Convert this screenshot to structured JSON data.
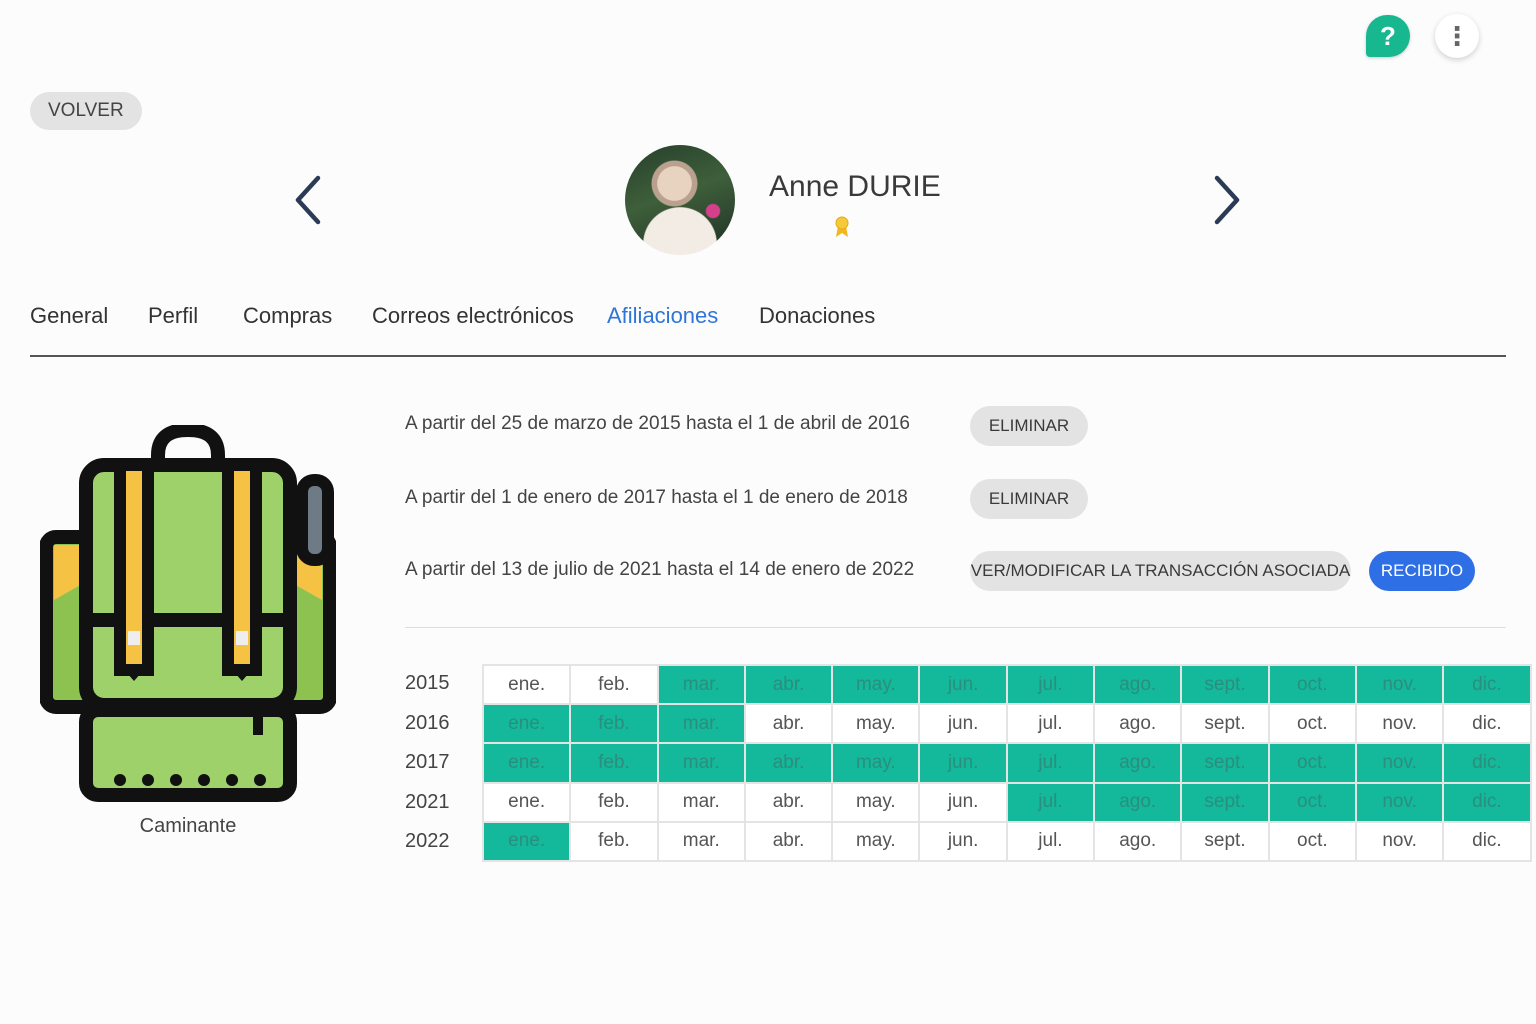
{
  "header": {
    "help_icon": "question-icon",
    "more_icon": "vertical-dots-icon",
    "help_label": "?",
    "more_label": "⋮"
  },
  "back_label": "VOLVER",
  "profile": {
    "name": "Anne DURIE",
    "badge_icon": "award-ribbon-icon"
  },
  "tabs": [
    {
      "label": "General"
    },
    {
      "label": "Perfil"
    },
    {
      "label": "Compras"
    },
    {
      "label": "Correos electrónicos"
    },
    {
      "label": "Afiliaciones",
      "active": true
    },
    {
      "label": "Donaciones"
    }
  ],
  "membership": {
    "icon": "backpack-icon",
    "caption": "Caminante"
  },
  "periods": [
    {
      "text": "A partir del 25 de marzo de 2015 hasta el 1 de abril de 2016",
      "action": "ELIMINAR"
    },
    {
      "text": "A partir del 1 de enero de 2017 hasta el 1 de enero de 2018",
      "action": "ELIMINAR"
    },
    {
      "text": "A partir del 13 de julio de 2021 hasta el 14 de enero de 2022",
      "action": "VER/MODIFICAR LA TRANSACCIÓN ASOCIADA",
      "status": "RECIBIDO"
    }
  ],
  "months": [
    "ene.",
    "feb.",
    "mar.",
    "abr.",
    "may.",
    "jun.",
    "jul.",
    "ago.",
    "sept.",
    "oct.",
    "nov.",
    "dic."
  ],
  "calendar": [
    {
      "year": "2015",
      "active": [
        false,
        false,
        true,
        true,
        true,
        true,
        true,
        true,
        true,
        true,
        true,
        true
      ]
    },
    {
      "year": "2016",
      "active": [
        true,
        true,
        true,
        false,
        false,
        false,
        false,
        false,
        false,
        false,
        false,
        false
      ]
    },
    {
      "year": "2017",
      "active": [
        true,
        true,
        true,
        true,
        true,
        true,
        true,
        true,
        true,
        true,
        true,
        true
      ]
    },
    {
      "year": "2021",
      "active": [
        false,
        false,
        false,
        false,
        false,
        false,
        true,
        true,
        true,
        true,
        true,
        true
      ]
    },
    {
      "year": "2022",
      "active": [
        true,
        false,
        false,
        false,
        false,
        false,
        false,
        false,
        false,
        false,
        false,
        false
      ]
    }
  ],
  "colors": {
    "active_month": "#14b89a",
    "accent_blue": "#2f6fe6",
    "help_green": "#17b890"
  }
}
